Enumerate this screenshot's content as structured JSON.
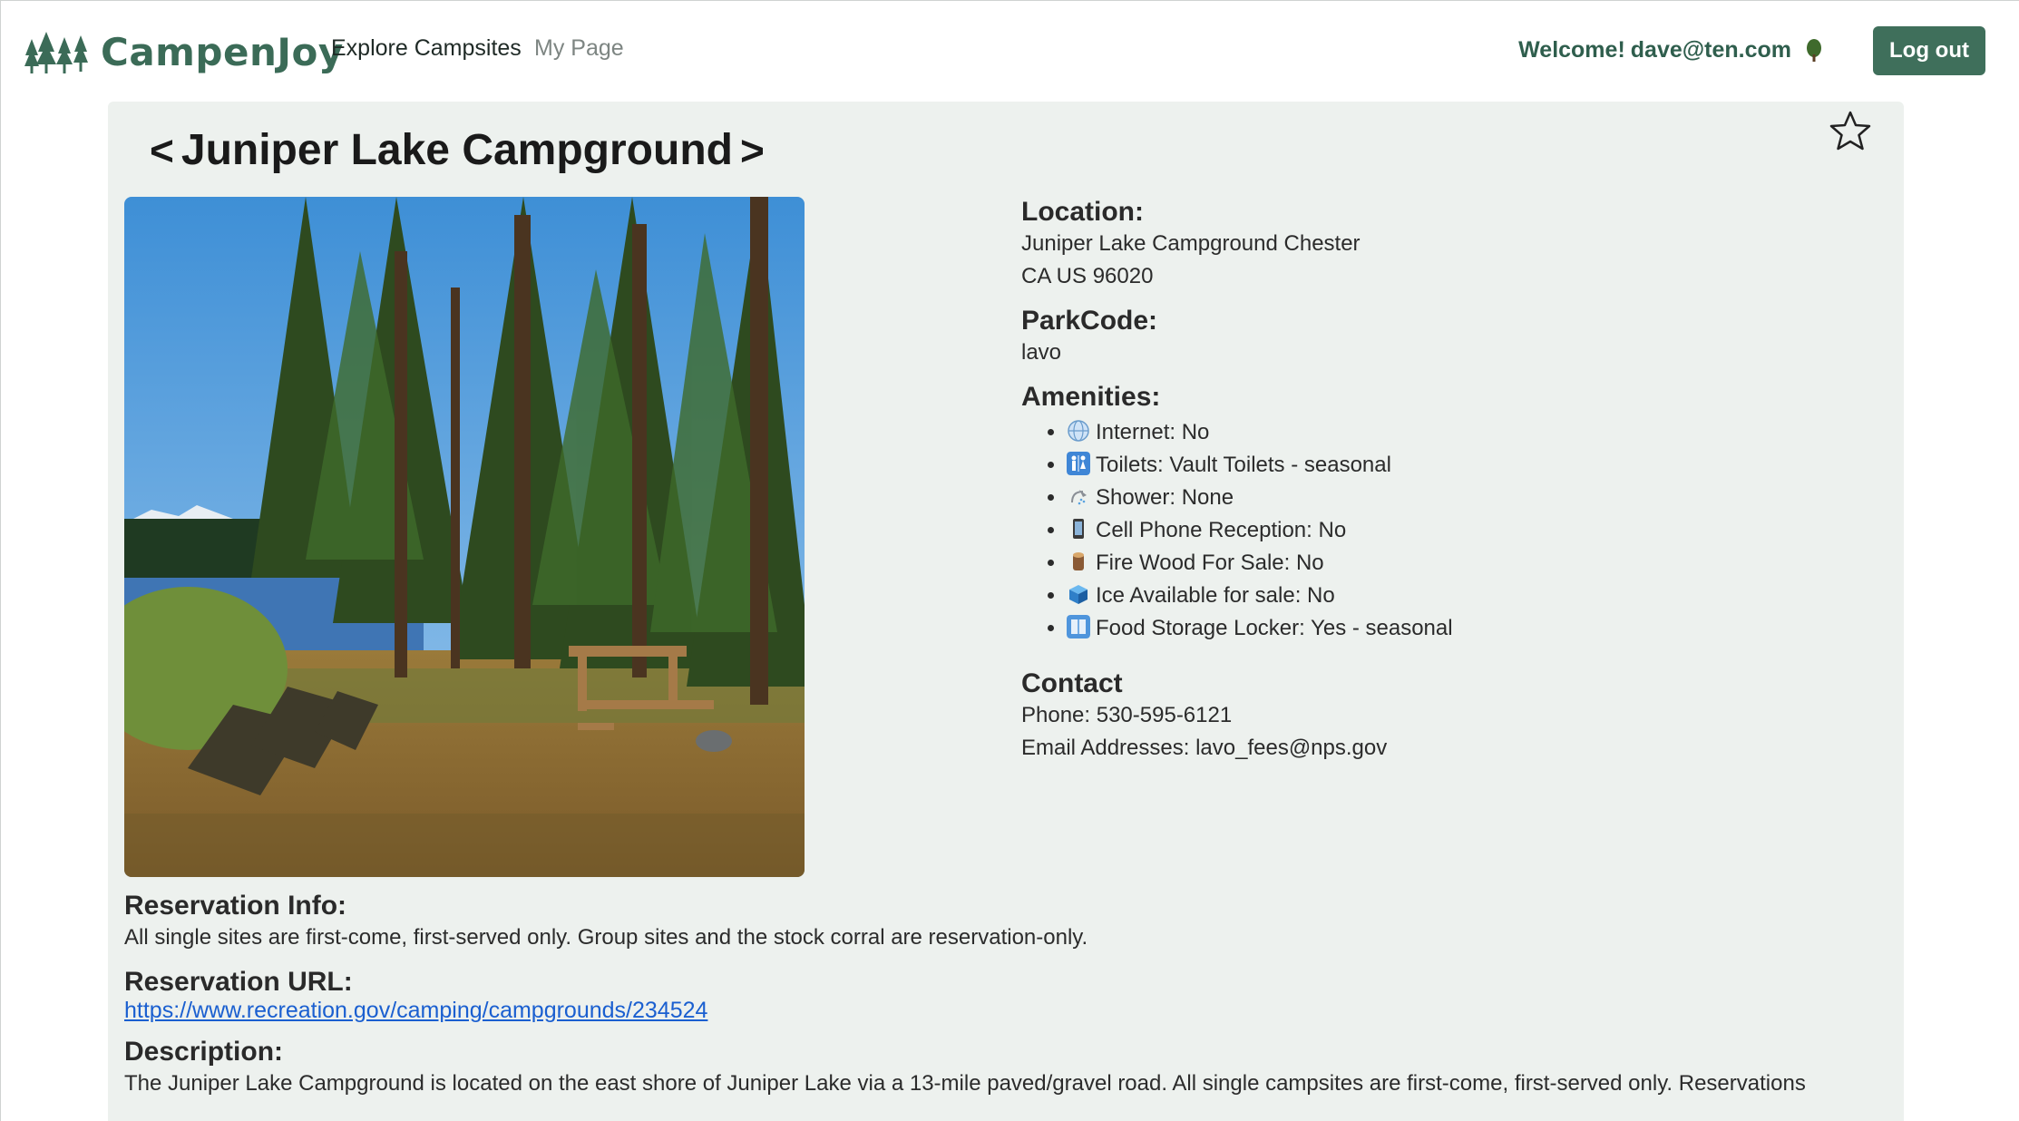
{
  "nav": {
    "brand": "CampenJoy",
    "links": [
      "Explore Campsites",
      "My Page"
    ],
    "welcome_label": "Welcome!",
    "user_email": "dave@ten.com",
    "logout_label": "Log out"
  },
  "campground": {
    "title": "Juniper Lake Campground",
    "prev_symbol": "<",
    "next_symbol": ">",
    "location_heading": "Location:",
    "location_line1": "Juniper Lake Campground Chester",
    "location_line2": "CA US 96020",
    "parkcode_heading": "ParkCode:",
    "parkcode": "lavo",
    "amenities_heading": "Amenities:",
    "amenities": [
      {
        "icon": "globe-icon",
        "text": "Internet: No"
      },
      {
        "icon": "restroom-icon",
        "text": "Toilets: Vault Toilets - seasonal"
      },
      {
        "icon": "shower-icon",
        "text": "Shower: None"
      },
      {
        "icon": "mobile-phone-icon",
        "text": "Cell Phone Reception: No"
      },
      {
        "icon": "firewood-icon",
        "text": "Fire Wood For Sale: No"
      },
      {
        "icon": "ice-cube-icon",
        "text": "Ice Available for sale: No"
      },
      {
        "icon": "locker-icon",
        "text": "Food Storage Locker: Yes - seasonal"
      }
    ],
    "contact_heading": "Contact",
    "phone": "Phone: 530-595-6121",
    "email": "Email Addresses: lavo_fees@nps.gov",
    "reservation_info_heading": "Reservation Info:",
    "reservation_info": "All single sites are first-come, first-served only. Group sites and the stock corral are reservation-only.",
    "reservation_url_heading": "Reservation URL:",
    "reservation_url": "https://www.recreation.gov/camping/campgrounds/234524",
    "description_heading": "Description:",
    "description": "The Juniper Lake Campground is located on the east shore of Juniper Lake via a 13-mile paved/gravel road. All single campsites are first-come, first-served only. Reservations"
  },
  "colors": {
    "brand": "#3b6b57",
    "button": "#3f6f5b",
    "card": "#edf1ee",
    "link": "#1a5fd0"
  }
}
